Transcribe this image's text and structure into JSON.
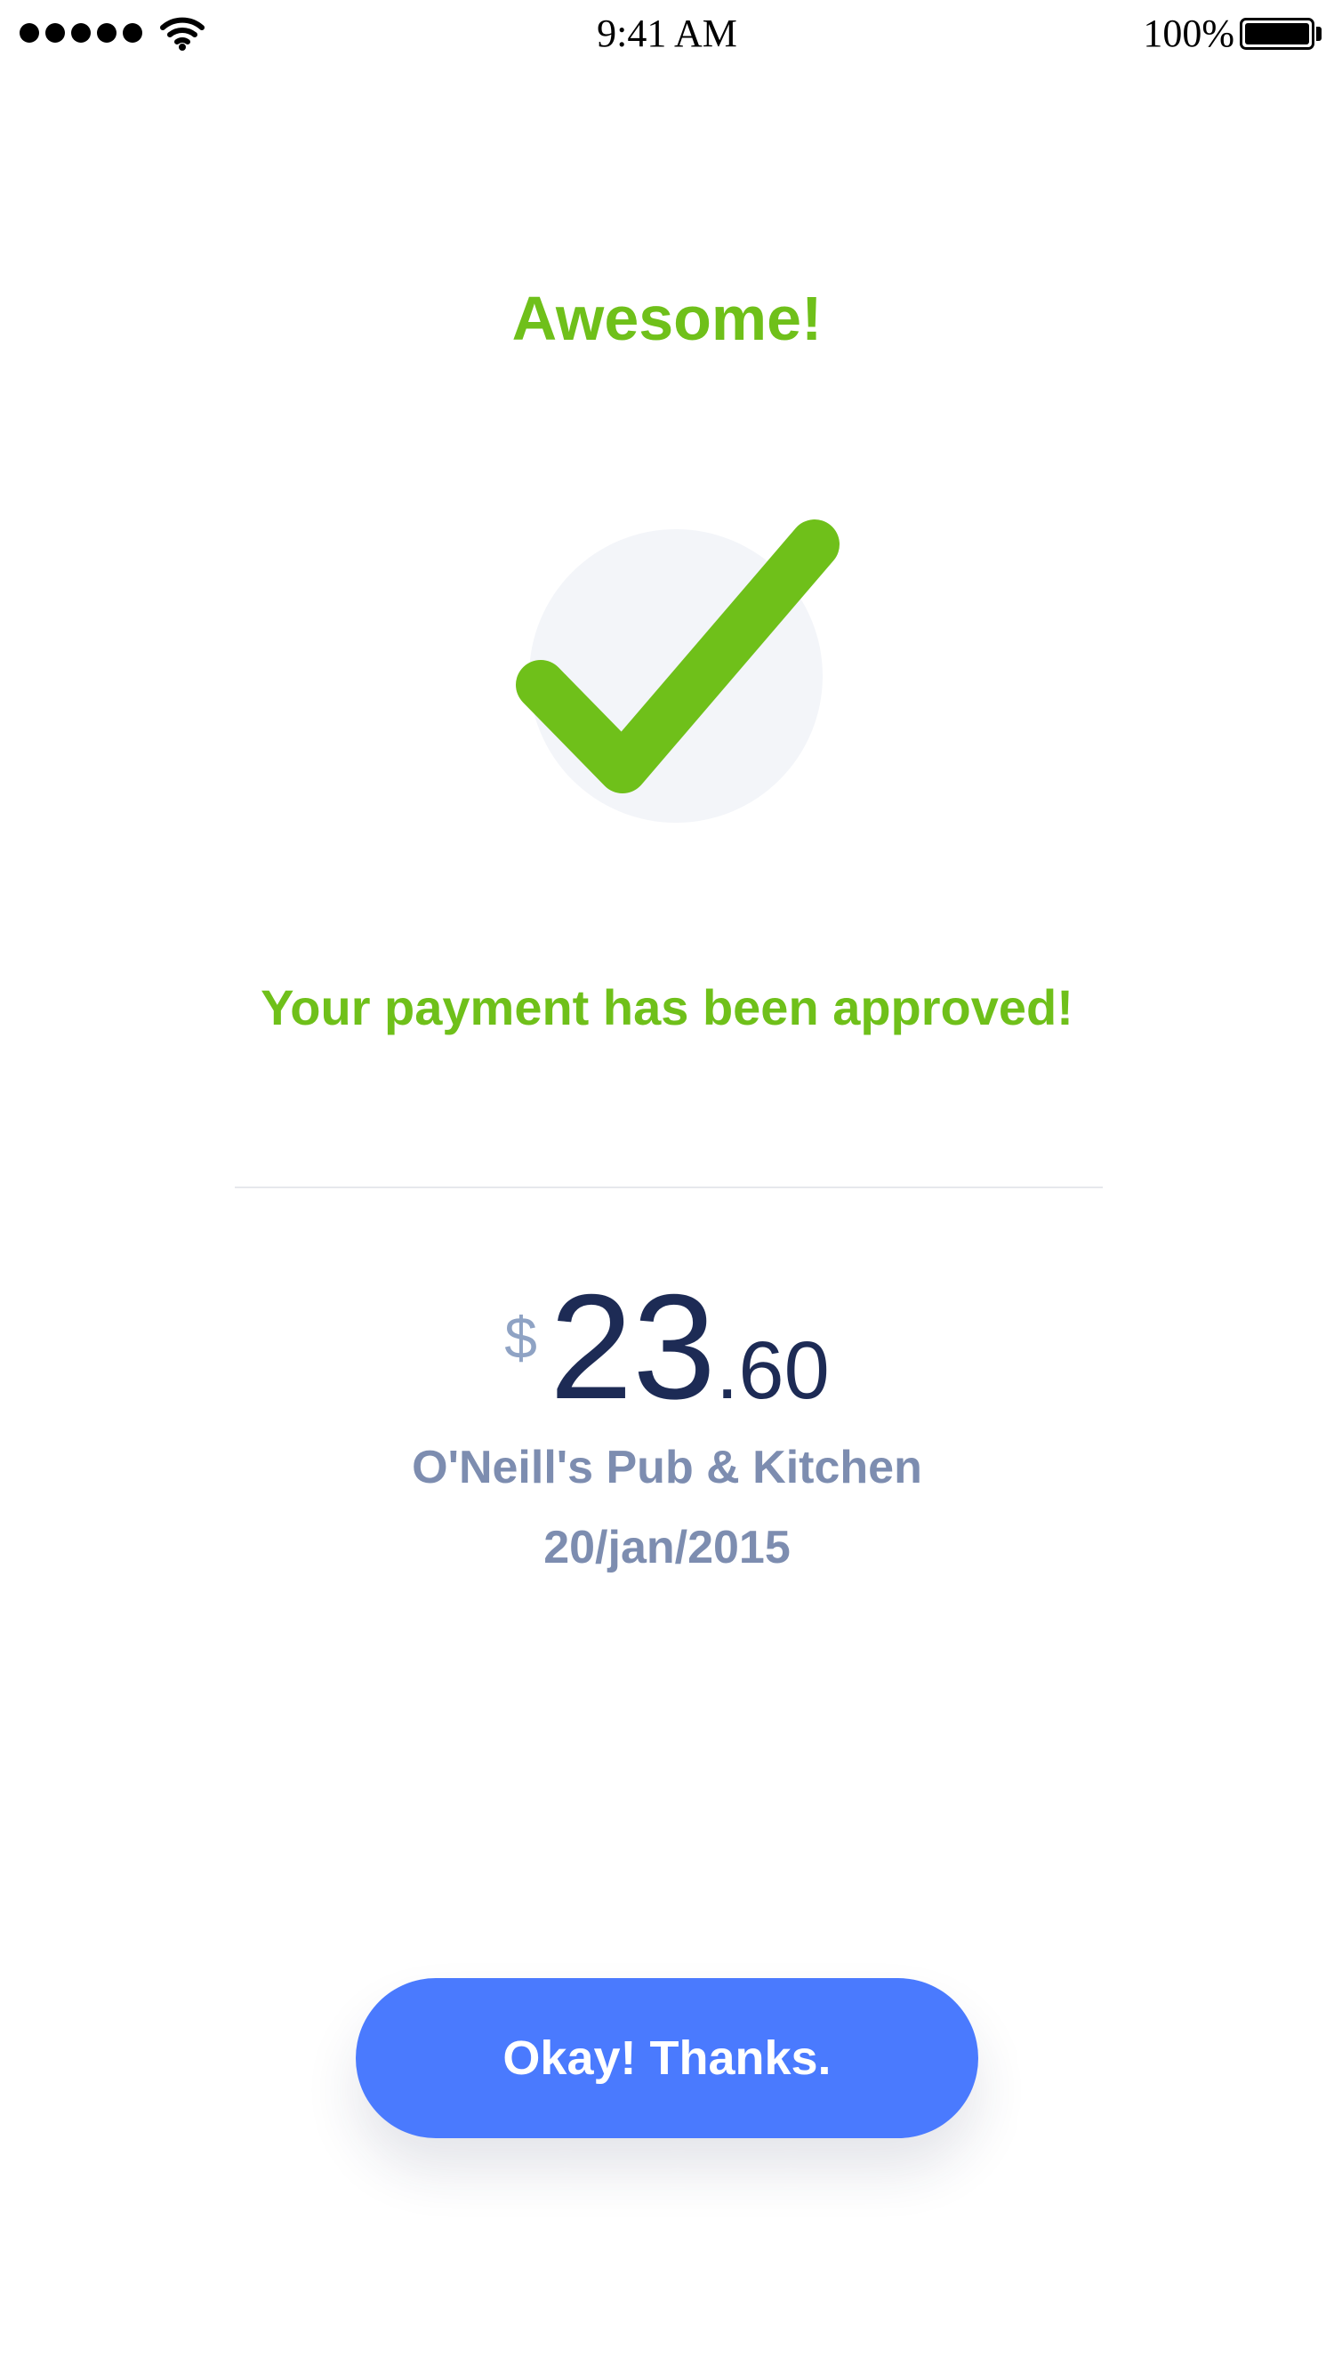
{
  "status_bar": {
    "time": "9:41 AM",
    "battery_percent": "100%",
    "signal_bars": 5,
    "icons": [
      "signal-dots-icon",
      "wifi-icon",
      "battery-icon"
    ]
  },
  "success": {
    "headline": "Awesome!",
    "icon": "checkmark-icon",
    "message": "Your payment has been approved!"
  },
  "payment": {
    "currency_symbol": "$",
    "amount_whole": "23",
    "amount_cents": ".60",
    "merchant": "O'Neill's Pub & Kitchen",
    "date": "20/jan/2015"
  },
  "actions": {
    "confirm_label": "Okay! Thanks."
  },
  "colors": {
    "success_green": "#6fc01a",
    "primary_blue": "#4a7afe",
    "amount_navy": "#1d2b55",
    "muted_text": "#7d8db0",
    "currency_gray": "#8fa3c4",
    "check_backdrop": "#f3f5f9"
  }
}
